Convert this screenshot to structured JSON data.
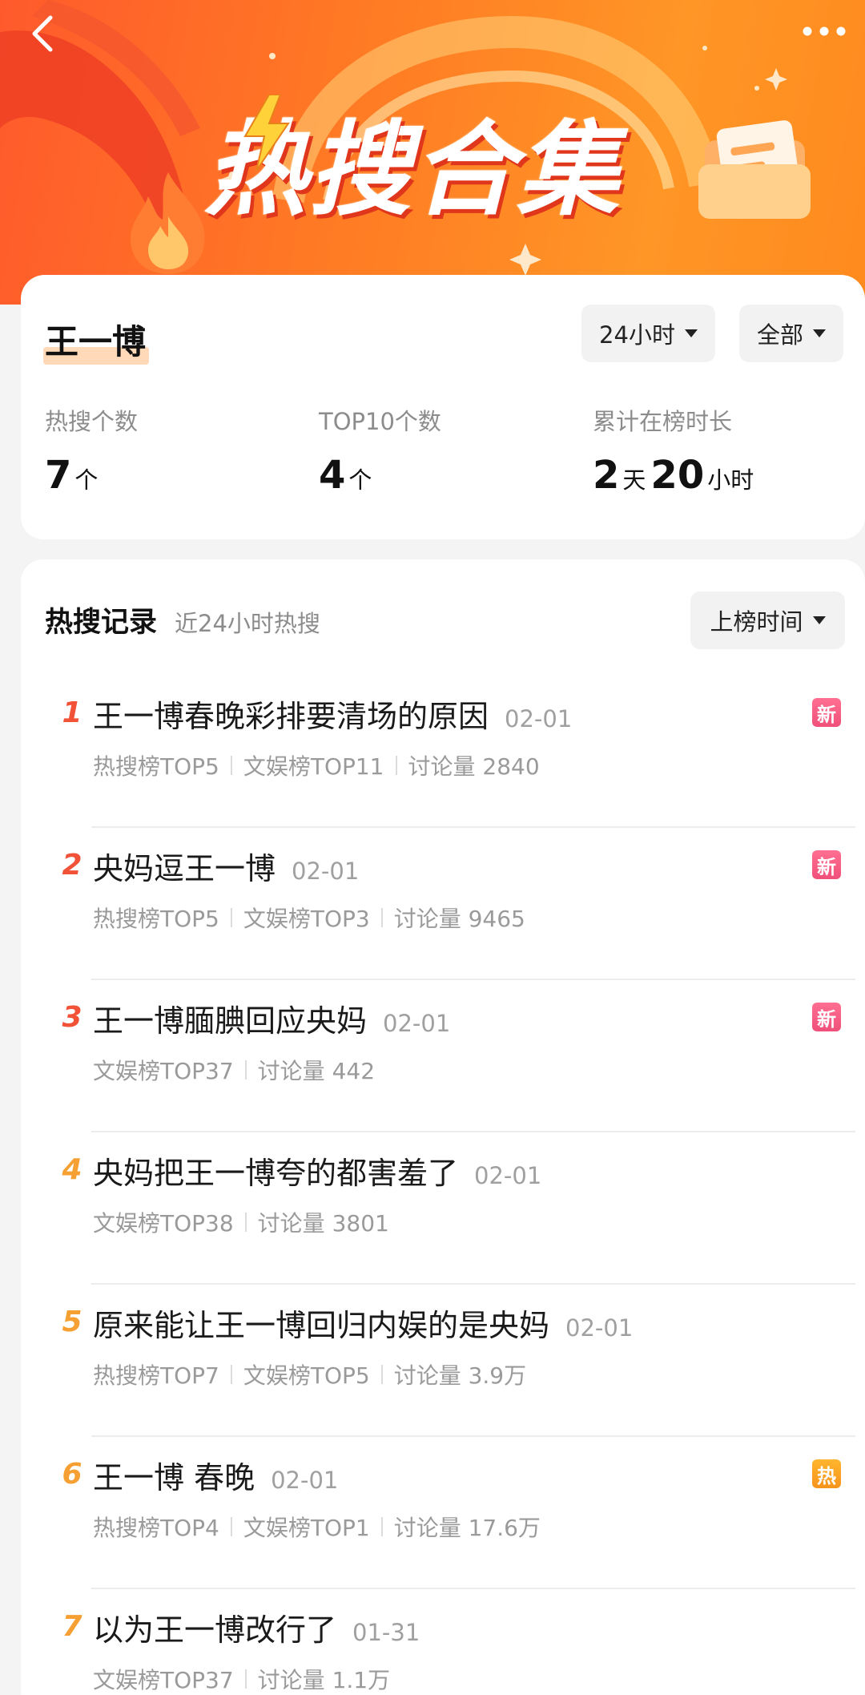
{
  "banner": {
    "title": "热搜合集",
    "icons": {
      "back": "back-chevron-icon",
      "more": "more-dots-icon",
      "fire": "flame-icon",
      "folder": "folder-icon",
      "bolt": "lightning-icon"
    }
  },
  "summary": {
    "name": "王一博",
    "period_filter": "24小时",
    "scope_filter": "全部",
    "stats": [
      {
        "label": "热搜个数",
        "value": "7",
        "unit": "个"
      },
      {
        "label": "TOP10个数",
        "value": "4",
        "unit": "个"
      },
      {
        "label": "累计在榜时长",
        "days": "2",
        "days_unit": "天",
        "hours": "20",
        "hours_unit": "小时"
      }
    ]
  },
  "records": {
    "title": "热搜记录",
    "subtitle": "近24小时热搜",
    "sort_filter": "上榜时间",
    "items": [
      {
        "rank": "1",
        "title": "王一博春晚彩排要清场的原因",
        "date": "02-01",
        "meta": [
          "热搜榜TOP5",
          "文娱榜TOP11",
          "讨论量 2840"
        ],
        "badge": "新"
      },
      {
        "rank": "2",
        "title": "央妈逗王一博",
        "date": "02-01",
        "meta": [
          "热搜榜TOP5",
          "文娱榜TOP3",
          "讨论量 9465"
        ],
        "badge": "新"
      },
      {
        "rank": "3",
        "title": "王一博腼腆回应央妈",
        "date": "02-01",
        "meta": [
          "文娱榜TOP37",
          "讨论量 442"
        ],
        "badge": "新"
      },
      {
        "rank": "4",
        "title": "央妈把王一博夸的都害羞了",
        "date": "02-01",
        "meta": [
          "文娱榜TOP38",
          "讨论量 3801"
        ],
        "badge": ""
      },
      {
        "rank": "5",
        "title": "原来能让王一博回归内娱的是央妈",
        "date": "02-01",
        "meta": [
          "热搜榜TOP7",
          "文娱榜TOP5",
          "讨论量 3.9万"
        ],
        "badge": ""
      },
      {
        "rank": "6",
        "title": "王一博 春晚",
        "date": "02-01",
        "meta": [
          "热搜榜TOP4",
          "文娱榜TOP1",
          "讨论量 17.6万"
        ],
        "badge": "热"
      },
      {
        "rank": "7",
        "title": "以为王一博改行了",
        "date": "01-31",
        "meta": [
          "文娱榜TOP37",
          "讨论量 1.1万"
        ],
        "badge": ""
      }
    ]
  },
  "colors": {
    "banner_start": "#ff5a2c",
    "banner_end": "#ff9626",
    "rank_top": "#f25238",
    "rank_mid": "#f6a033",
    "badge_new": "#f0507a",
    "badge_hot": "#f6941c"
  }
}
